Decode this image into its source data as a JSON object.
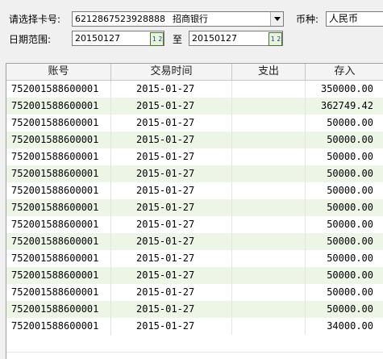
{
  "filters": {
    "card_label": "请选择卡号:",
    "card_value": "6212867523928888",
    "bank_value": "招商银行",
    "currency_label": "币种:",
    "currency_value": "人民币",
    "date_label": "日期范围:",
    "date_from": "20150127",
    "date_to_label": "至",
    "date_to": "20150127",
    "calendar_button_text": "1 2"
  },
  "table": {
    "columns": [
      "账号",
      "交易时间",
      "支出",
      "存入"
    ],
    "rows": [
      {
        "account": "752001588600001",
        "time": "2015-01-27",
        "out": "",
        "in": "350000.00"
      },
      {
        "account": "752001588600001",
        "time": "2015-01-27",
        "out": "",
        "in": "362749.42"
      },
      {
        "account": "752001588600001",
        "time": "2015-01-27",
        "out": "",
        "in": "50000.00"
      },
      {
        "account": "752001588600001",
        "time": "2015-01-27",
        "out": "",
        "in": "50000.00"
      },
      {
        "account": "752001588600001",
        "time": "2015-01-27",
        "out": "",
        "in": "50000.00"
      },
      {
        "account": "752001588600001",
        "time": "2015-01-27",
        "out": "",
        "in": "50000.00"
      },
      {
        "account": "752001588600001",
        "time": "2015-01-27",
        "out": "",
        "in": "50000.00"
      },
      {
        "account": "752001588600001",
        "time": "2015-01-27",
        "out": "",
        "in": "50000.00"
      },
      {
        "account": "752001588600001",
        "time": "2015-01-27",
        "out": "",
        "in": "50000.00"
      },
      {
        "account": "752001588600001",
        "time": "2015-01-27",
        "out": "",
        "in": "50000.00"
      },
      {
        "account": "752001588600001",
        "time": "2015-01-27",
        "out": "",
        "in": "50000.00"
      },
      {
        "account": "752001588600001",
        "time": "2015-01-27",
        "out": "",
        "in": "50000.00"
      },
      {
        "account": "752001588600001",
        "time": "2015-01-27",
        "out": "",
        "in": "50000.00"
      },
      {
        "account": "752001588600001",
        "time": "2015-01-27",
        "out": "",
        "in": "50000.00"
      },
      {
        "account": "752001588600001",
        "time": "2015-01-27",
        "out": "",
        "in": "34000.00"
      }
    ]
  },
  "colors": {
    "row_alt": "#ecf5e6",
    "panel": "#f0f0f0"
  }
}
